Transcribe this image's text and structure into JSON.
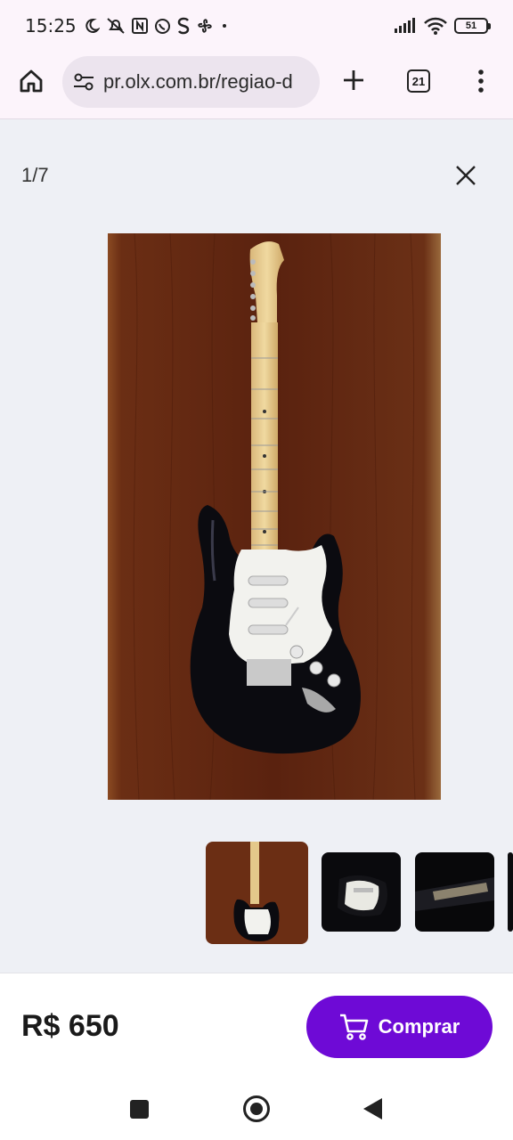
{
  "status_bar": {
    "time": "15:25",
    "battery": "51",
    "icons_left": [
      "moon-icon",
      "bell-off-icon",
      "nfc-icon",
      "whatsapp-icon",
      "s-app-icon",
      "fan-icon",
      "dot-icon"
    ],
    "icons_right": [
      "signal-icon",
      "wifi-icon",
      "battery-icon"
    ]
  },
  "browser": {
    "url": "pr.olx.com.br/regiao-d",
    "tab_count": "21"
  },
  "gallery": {
    "counter": "1/7"
  },
  "listing": {
    "price": "R$ 650",
    "buy_label": "Comprar"
  },
  "colors": {
    "accent": "#6e0ad6",
    "background": "#eef0f5"
  }
}
